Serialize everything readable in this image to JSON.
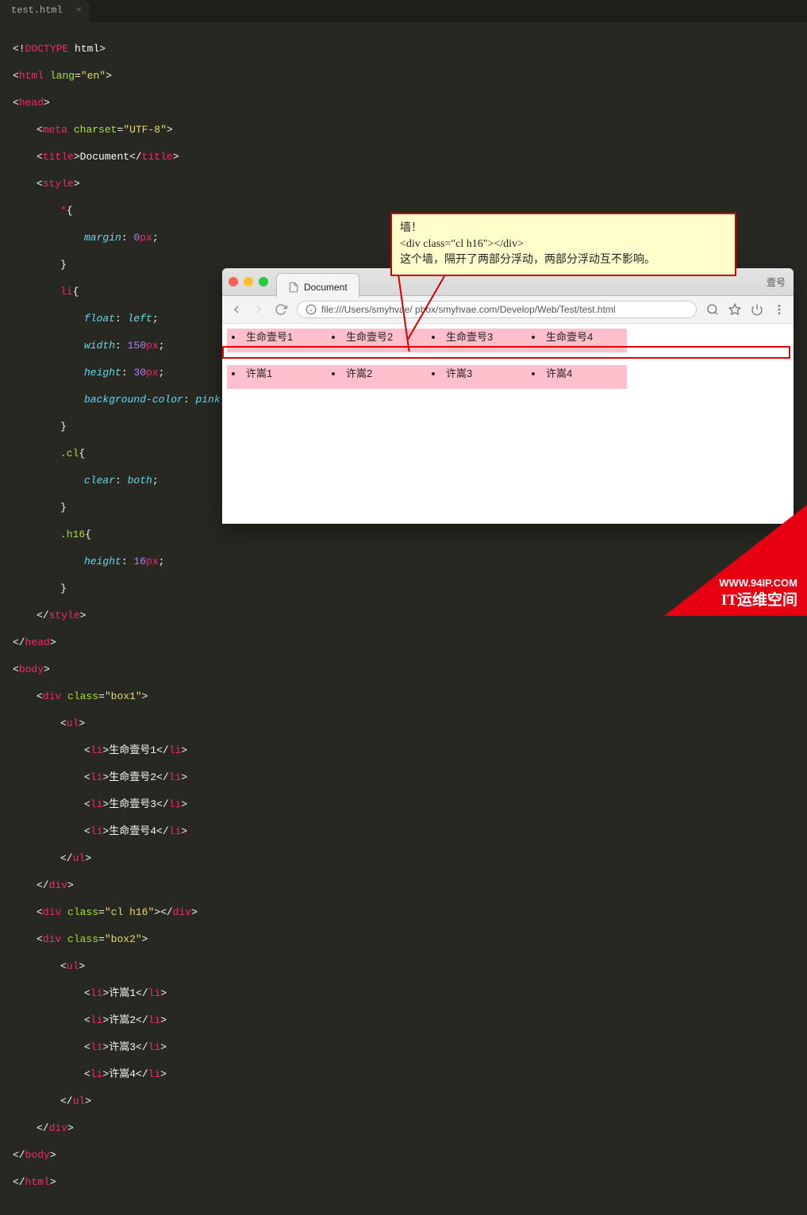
{
  "editor": {
    "tab": {
      "filename": "test.html",
      "close": "×"
    }
  },
  "code": {
    "doctype_lit": "DOCTYPE",
    "html_tag": "html",
    "lang_attr": "lang",
    "lang_val": "\"en\"",
    "head": "head",
    "meta": "meta",
    "charset_attr": "charset",
    "charset_val": "\"UTF-8\"",
    "title_tag": "title",
    "title_txt": "Document",
    "style_tag": "style",
    "sel_star": "*",
    "prop_margin": "margin",
    "val_0": "0",
    "unit_px": "px",
    "sel_li": "li",
    "prop_float": "float",
    "val_left": "left",
    "prop_width": "width",
    "val_150": "150",
    "prop_height": "height",
    "val_30": "30",
    "prop_bg": "background-color",
    "val_pink": "pink",
    "sel_cl": ".cl",
    "prop_clear": "clear",
    "val_both": "both",
    "sel_h16": ".h16",
    "val_16": "16",
    "body_tag": "body",
    "div_tag": "div",
    "class_attr": "class",
    "box1_val": "\"box1\"",
    "ul_tag": "ul",
    "li_tag": "li",
    "li1_1": "生命壹号1",
    "li1_2": "生命壹号2",
    "li1_3": "生命壹号3",
    "li1_4": "生命壹号4",
    "clh16_val": "\"cl h16\"",
    "box2_val": "\"box2\"",
    "li2_1": "许嵩1",
    "li2_2": "许嵩2",
    "li2_3": "许嵩3",
    "li2_4": "许嵩4"
  },
  "callout": {
    "line1": "墙！",
    "line2": "<div class=\"cl h16\"></div>",
    "line3": "这个墙，隔开了两部分浮动，两部分浮动互不影响。"
  },
  "browser": {
    "tab_title": "Document",
    "profile": "壹号",
    "url": "file:///Users/smyhvae/     pbox/smyhvae.com/Develop/Web/Test/test.html",
    "list1": [
      "生命壹号1",
      "生命壹号2",
      "生命壹号3",
      "生命壹号4"
    ],
    "list2": [
      "许嵩1",
      "许嵩2",
      "许嵩3",
      "许嵩4"
    ]
  },
  "watermark": {
    "line1": "WWW.94IP.COM",
    "line2": "IT运维空间"
  }
}
